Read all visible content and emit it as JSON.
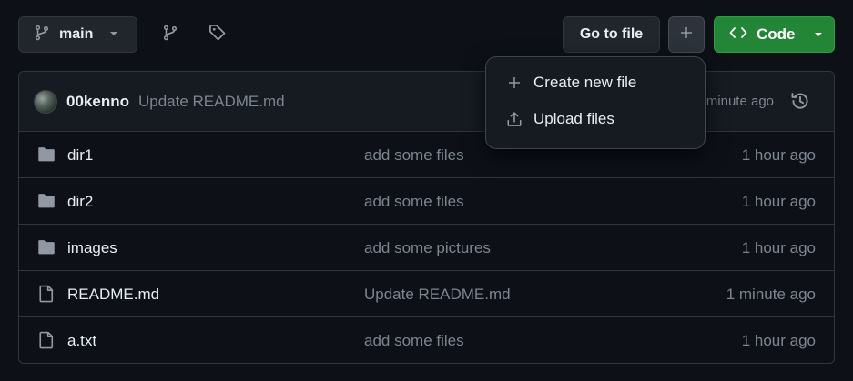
{
  "toolbar": {
    "branch_label": "main",
    "goto_label": "Go to file",
    "code_label": "Code"
  },
  "commit": {
    "author": "00kenno",
    "message": "Update README.md",
    "time": "minute ago"
  },
  "dropdown": {
    "items": [
      {
        "label": "Create new file",
        "icon": "plus-icon"
      },
      {
        "label": "Upload files",
        "icon": "upload-icon"
      }
    ]
  },
  "files": [
    {
      "type": "folder",
      "name": "dir1",
      "commit": "add some files",
      "time": "1 hour ago"
    },
    {
      "type": "folder",
      "name": "dir2",
      "commit": "add some files",
      "time": "1 hour ago"
    },
    {
      "type": "folder",
      "name": "images",
      "commit": "add some pictures",
      "time": "1 hour ago"
    },
    {
      "type": "file",
      "name": "README.md",
      "commit": "Update README.md",
      "time": "1 minute ago"
    },
    {
      "type": "file",
      "name": "a.txt",
      "commit": "add some files",
      "time": "1 hour ago"
    }
  ],
  "colors": {
    "background": "#0d1117",
    "code_button": "#238636",
    "muted_text": "#7d8590",
    "border": "#30363d"
  }
}
